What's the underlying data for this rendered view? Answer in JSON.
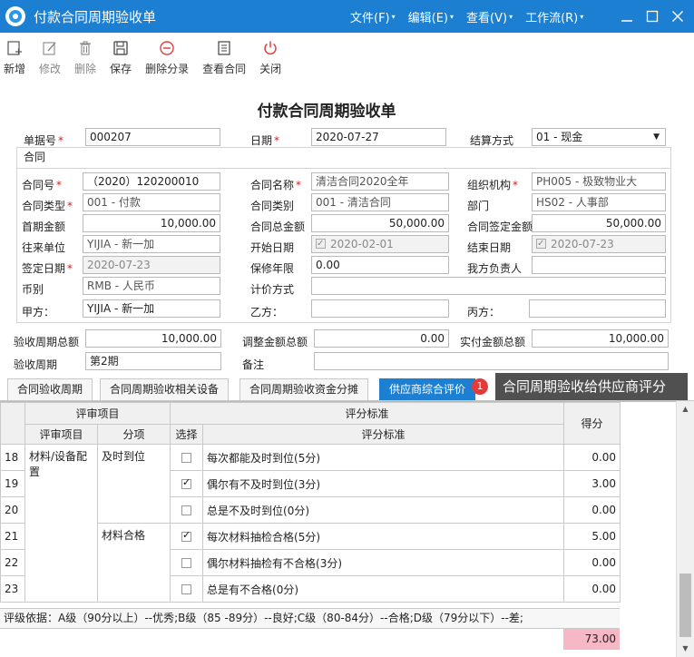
{
  "window": {
    "title": "付款合同周期验收单"
  },
  "menu": [
    {
      "label": "文件(F)"
    },
    {
      "label": "编辑(E)"
    },
    {
      "label": "查看(V)"
    },
    {
      "label": "工作流(R)"
    }
  ],
  "toolbar": {
    "new_label": "新增",
    "edit_label": "修改",
    "delete_label": "删除",
    "save_label": "保存",
    "delete_entry_label": "删除分录",
    "view_contract_label": "查看合同",
    "close_label": "关闭"
  },
  "doc": {
    "title": "付款合同周期验收单"
  },
  "form": {
    "bill_no_label": "单据号",
    "bill_no": "000207",
    "date_label": "日期",
    "date": "2020-07-27",
    "settle_label": "结算方式",
    "settle": "01 - 现金",
    "group_label": "合同",
    "contract_no_label": "合同号",
    "contract_no": "（2020）120200010",
    "contract_name_label": "合同名称",
    "contract_name": "清洁合同2020全年",
    "org_label": "组织机构",
    "org": "PH005 - 极致物业大",
    "contract_type_label": "合同类型",
    "contract_type": "001 - 付款",
    "contract_cat_label": "合同类别",
    "contract_cat": "001 - 清洁合同",
    "dept_label": "部门",
    "dept": "HS02 - 人事部",
    "first_amt_label": "首期金额",
    "first_amt": "10,000.00",
    "total_amt_label": "合同总金额",
    "total_amt": "50,000.00",
    "signed_amt_label": "合同签定金额",
    "signed_amt": "50,000.00",
    "partner_label": "往来单位",
    "partner": "YIJIA - 新一加",
    "start_label": "开始日期",
    "start": "2020-02-01",
    "end_label": "结束日期",
    "end": "2020-07-23",
    "sign_date_label": "签定日期",
    "sign_date": "2020-07-23",
    "warranty_label": "保修年限",
    "warranty": "0.00",
    "owner_label": "我方负责人",
    "owner": "",
    "currency_label": "币别",
    "currency": "RMB - 人民币",
    "pricing_label": "计价方式",
    "pricing": "",
    "party_a_label": "甲方：",
    "party_a": "YIJIA - 新一加",
    "party_b_label": "乙方：",
    "party_b": "",
    "party_c_label": "丙方：",
    "party_c": "",
    "period_total_label": "验收周期总额",
    "period_total": "10,000.00",
    "adjust_total_label": "调整金额总额",
    "adjust_total": "0.00",
    "actual_total_label": "实付金额总额",
    "actual_total": "10,000.00",
    "period_label": "验收周期",
    "period": "第2期",
    "remark_label": "备注",
    "remark": ""
  },
  "tabs": [
    {
      "label": "合同验收周期"
    },
    {
      "label": "合同周期验收相关设备"
    },
    {
      "label": "合同周期验收资金分摊"
    },
    {
      "label": "供应商综合评价"
    }
  ],
  "tab_badge": "1",
  "tooltip": "合同周期验收给供应商评分",
  "grid": {
    "h_review_item": "评审项目",
    "h_standard": "评分标准",
    "h_score": "得分",
    "h_item": "评审项目",
    "h_sub": "分项",
    "h_select": "选择",
    "h_std": "评分标准",
    "rows": [
      {
        "no": "18",
        "item": "材料/设备配置",
        "sub": "及时到位",
        "checked": false,
        "std": "每次都能及时到位(5分)",
        "score": "0.00"
      },
      {
        "no": "19",
        "item": "",
        "sub": "",
        "checked": true,
        "std": "偶尔有不及时到位(3分)",
        "score": "3.00"
      },
      {
        "no": "20",
        "item": "",
        "sub": "",
        "checked": false,
        "std": "总是不及时到位(0分)",
        "score": "0.00"
      },
      {
        "no": "21",
        "item": "",
        "sub": "材料合格",
        "checked": true,
        "std": "每次材料抽检合格(5分)",
        "score": "5.00"
      },
      {
        "no": "22",
        "item": "",
        "sub": "",
        "checked": false,
        "std": "偶尔材料抽检有不合格(3分)",
        "score": "0.00"
      },
      {
        "no": "23",
        "item": "",
        "sub": "",
        "checked": false,
        "std": "总是有不合格(0分)",
        "score": "0.00"
      }
    ],
    "note": "评级依据：A级（90分以上）--优秀;B级（85 -89分）--良好;C级（80-84分）--合格;D级（79分以下）--差;",
    "total": "73.00"
  }
}
